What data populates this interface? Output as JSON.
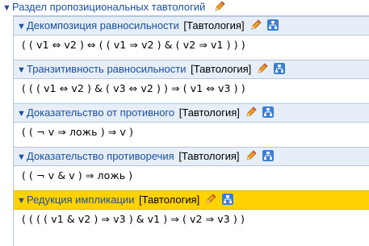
{
  "root": {
    "title": "Раздел пропозициональных тавтологий"
  },
  "items": [
    {
      "title": "Декомпозиция равносильности",
      "tag": "[Тавтология]",
      "formula": "( ( v1 ⇔ v2 ) ⇔ ( ( v1 ⇒ v2 ) & ( v2 ⇒ v1 ) ) )",
      "active": false
    },
    {
      "title": "Транзитивность равносильности",
      "tag": "[Тавтология]",
      "formula": "( ( ( v1 ⇔ v2 ) & ( v3 ⇔ v2 ) ) ⇒ ( v1 ⇔ v3 ) )",
      "active": false
    },
    {
      "title": "Доказательство от противного",
      "tag": "[Тавтология]",
      "formula": "( ( ¬ v ⇒ ложь ) ⇒ v )",
      "active": false
    },
    {
      "title": "Доказательство противоречия",
      "tag": "[Тавтология]",
      "formula": "( ( ¬ v & v ) ⇒ ложь )",
      "active": false
    },
    {
      "title": "Редукция импликации",
      "tag": "[Тавтология]",
      "formula": "( ( ( ( v1 & v2 ) ⇒ v3 ) & v1 ) ⇒ ( v2 ⇒ v3 ) )",
      "active": true
    }
  ],
  "icons": {
    "expand": "triangle-down-icon",
    "edit": "pencil-icon",
    "tree": "sitemap-icon"
  },
  "colors": {
    "link": "#1a4fa3",
    "active_bg": "#ffd200",
    "header_bg": "#e6eef8",
    "border": "#b9c7d9"
  }
}
